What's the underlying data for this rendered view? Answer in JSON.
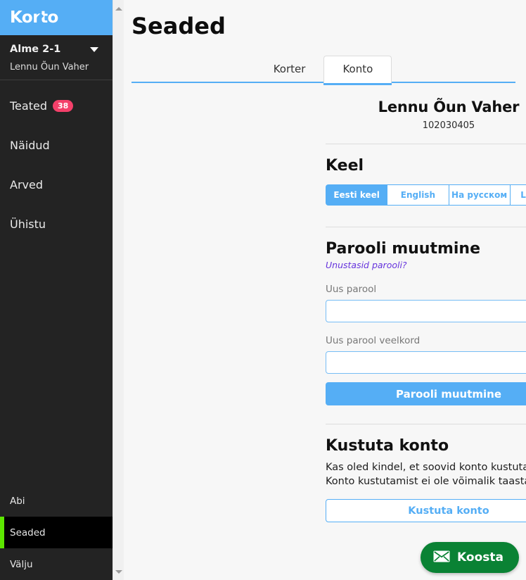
{
  "sidebar": {
    "logo": "Korto",
    "account": {
      "name": "Alme 2-1",
      "sub": "Lennu Õun Vaher",
      "caret_icon": "chevron-down-icon"
    },
    "nav": [
      {
        "label": "Teated",
        "badge": "38"
      },
      {
        "label": "Näidud",
        "badge": ""
      },
      {
        "label": "Arved",
        "badge": ""
      },
      {
        "label": "Ühistu",
        "badge": ""
      }
    ],
    "bottom": [
      {
        "label": "Abi",
        "active": false
      },
      {
        "label": "Seaded",
        "active": true
      },
      {
        "label": "Välju",
        "active": false
      }
    ],
    "scrollbar": {
      "up_icon": "scroll-up-arrow-icon",
      "down_icon": "scroll-down-arrow-icon"
    },
    "colors": {
      "logo_bar": "#55aef5",
      "background": "#232323",
      "active_marker": "#5ce600",
      "badge": "#f4406a"
    }
  },
  "main": {
    "page_title": "Seaded",
    "tabs": [
      {
        "label": "Korter",
        "active": false
      },
      {
        "label": "Konto",
        "active": true
      }
    ],
    "user": {
      "name": "Lennu Õun Vaher",
      "id": "102030405"
    },
    "language": {
      "title": "Keel",
      "options": [
        {
          "label": "Eesti keel",
          "active": true
        },
        {
          "label": "English",
          "active": false
        },
        {
          "label": "На русском",
          "active": false
        },
        {
          "label": "Latviešu",
          "active": false
        }
      ]
    },
    "password": {
      "title": "Parooli muutmine",
      "forgot_link": "Unustasid parooli?",
      "new_label": "Uus parool",
      "new_value": "",
      "new_placeholder": "",
      "repeat_label": "Uus parool veelkord",
      "repeat_value": "",
      "repeat_placeholder": "",
      "submit_label": "Parooli muutmine"
    },
    "delete": {
      "title": "Kustuta konto",
      "line1": "Kas oled kindel, et soovid konto kustutada?",
      "line2": "Konto kustutamist ei ole võimalik taastada!",
      "button_label": "Kustuta konto"
    },
    "colors": {
      "accent": "#55aef5",
      "link": "#6633dd"
    }
  },
  "fab": {
    "label": "Koosta",
    "icon": "envelope-icon",
    "color": "#0a8234"
  }
}
